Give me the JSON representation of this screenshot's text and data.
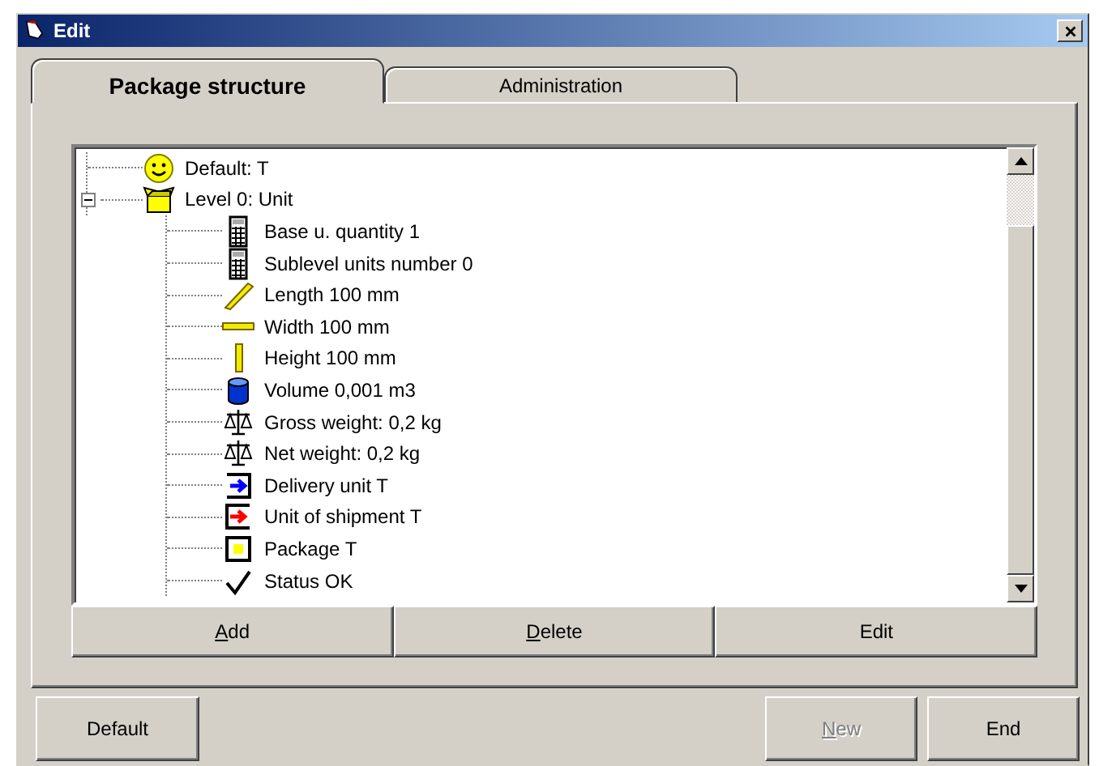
{
  "window": {
    "title": "Edit"
  },
  "tabs": [
    {
      "label": "Package structure",
      "selected": true
    },
    {
      "label": "Administration",
      "selected": false
    }
  ],
  "tree": {
    "items": [
      {
        "kind": "smiley",
        "label": "Default: T"
      },
      {
        "kind": "box",
        "label": "Level 0: Unit",
        "expanded": true,
        "children": [
          {
            "kind": "calculator",
            "label": "Base u. quantity 1"
          },
          {
            "kind": "calculator",
            "label": "Sublevel units number 0"
          },
          {
            "kind": "ruler-diagonal",
            "label": "Length 100 mm"
          },
          {
            "kind": "ruler-horizontal",
            "label": "Width 100 mm"
          },
          {
            "kind": "ruler-vertical",
            "label": "Height 100 mm"
          },
          {
            "kind": "cylinder",
            "label": "Volume 0,001 m3"
          },
          {
            "kind": "scale",
            "label": "Gross weight: 0,2 kg"
          },
          {
            "kind": "scale",
            "label": "Net weight: 0,2 kg"
          },
          {
            "kind": "arrow-blue",
            "label": "Delivery unit T"
          },
          {
            "kind": "arrow-red",
            "label": "Unit of shipment T"
          },
          {
            "kind": "square",
            "label": "Package T"
          },
          {
            "kind": "check",
            "label": "Status OK"
          }
        ]
      }
    ]
  },
  "tree_buttons": [
    {
      "label": "Add",
      "mnemonic": true,
      "disabled": false
    },
    {
      "label": "Delete",
      "mnemonic": true,
      "disabled": false
    },
    {
      "label": "Edit",
      "mnemonic": false,
      "disabled": false
    }
  ],
  "footer": {
    "left_buttons": [
      {
        "label": "Default",
        "mnemonic": false,
        "disabled": false
      }
    ],
    "right_buttons": [
      {
        "label": "New",
        "mnemonic": true,
        "disabled": true
      },
      {
        "label": "End",
        "mnemonic": false,
        "disabled": false
      }
    ]
  }
}
